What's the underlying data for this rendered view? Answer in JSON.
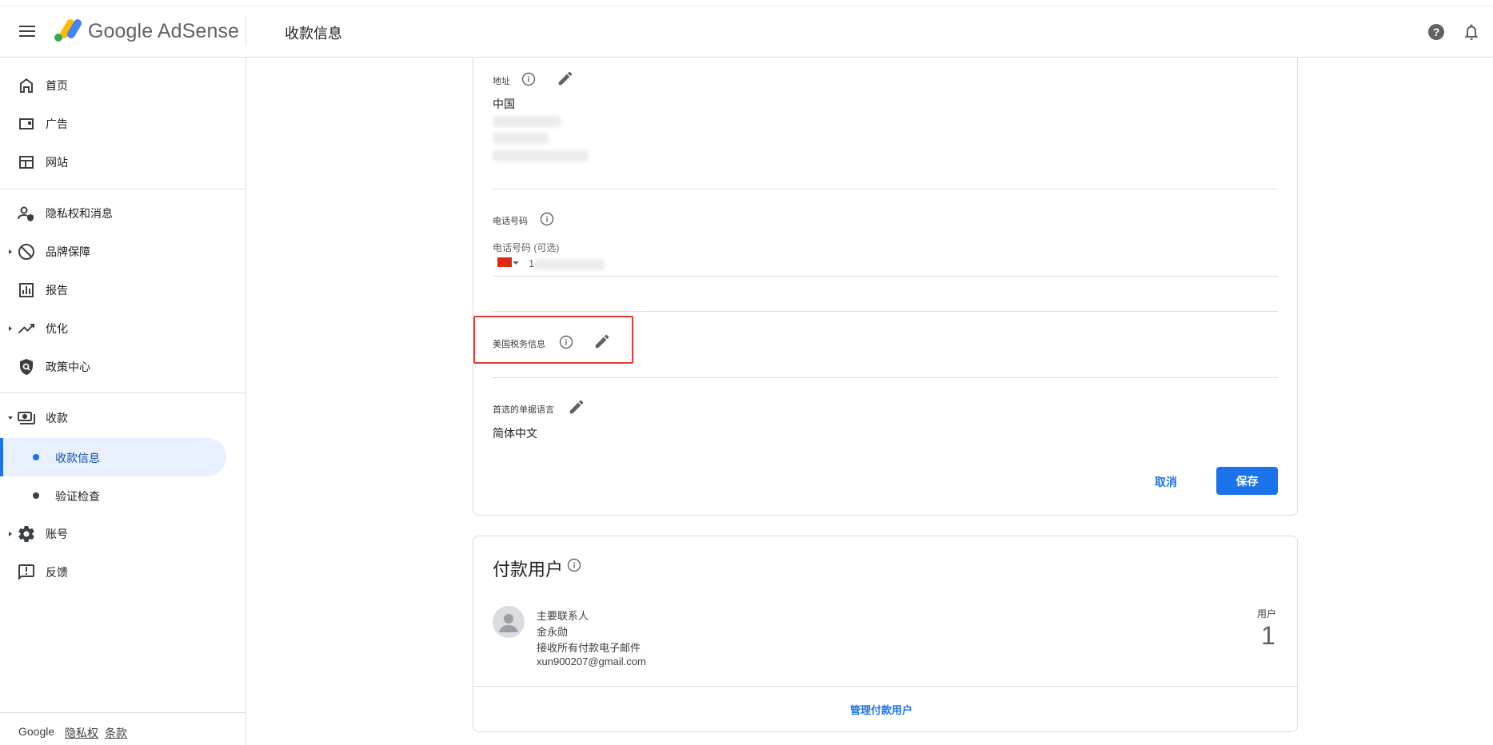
{
  "header": {
    "brand": "Google AdSense",
    "page_title": "收款信息"
  },
  "sidebar": {
    "items": [
      {
        "label": "首页"
      },
      {
        "label": "广告"
      },
      {
        "label": "网站"
      },
      {
        "label": "隐私权和消息"
      },
      {
        "label": "品牌保障"
      },
      {
        "label": "报告"
      },
      {
        "label": "优化"
      },
      {
        "label": "政策中心"
      },
      {
        "label": "收款"
      },
      {
        "label": "账号"
      },
      {
        "label": "反馈"
      }
    ],
    "sub_items": [
      {
        "label": "收款信息",
        "active": true
      },
      {
        "label": "验证检查",
        "active": false
      }
    ],
    "footer": {
      "google": "Google",
      "privacy": "隐私权",
      "terms": "条款"
    }
  },
  "payment_info": {
    "address_label": "地址",
    "address_country": "中国",
    "phone_label": "电话号码",
    "phone_field_label": "电话号码 (可选)",
    "phone_prefix": "1",
    "tax_label": "美国税务信息",
    "language_label": "首选的单据语言",
    "language_value": "简体中文",
    "cancel_label": "取消",
    "save_label": "保存"
  },
  "payment_users": {
    "title": "付款用户",
    "role": "主要联系人",
    "name": "金永勋",
    "email_pref": "接收所有付款电子邮件",
    "email": "xun900207@gmail.com",
    "users_label": "用户",
    "users_count": "1",
    "manage_label": "管理付款用户"
  },
  "colors": {
    "accent": "#1a73e8",
    "highlight_border": "#e53935",
    "active_nav_bg": "#e8f0fe"
  }
}
